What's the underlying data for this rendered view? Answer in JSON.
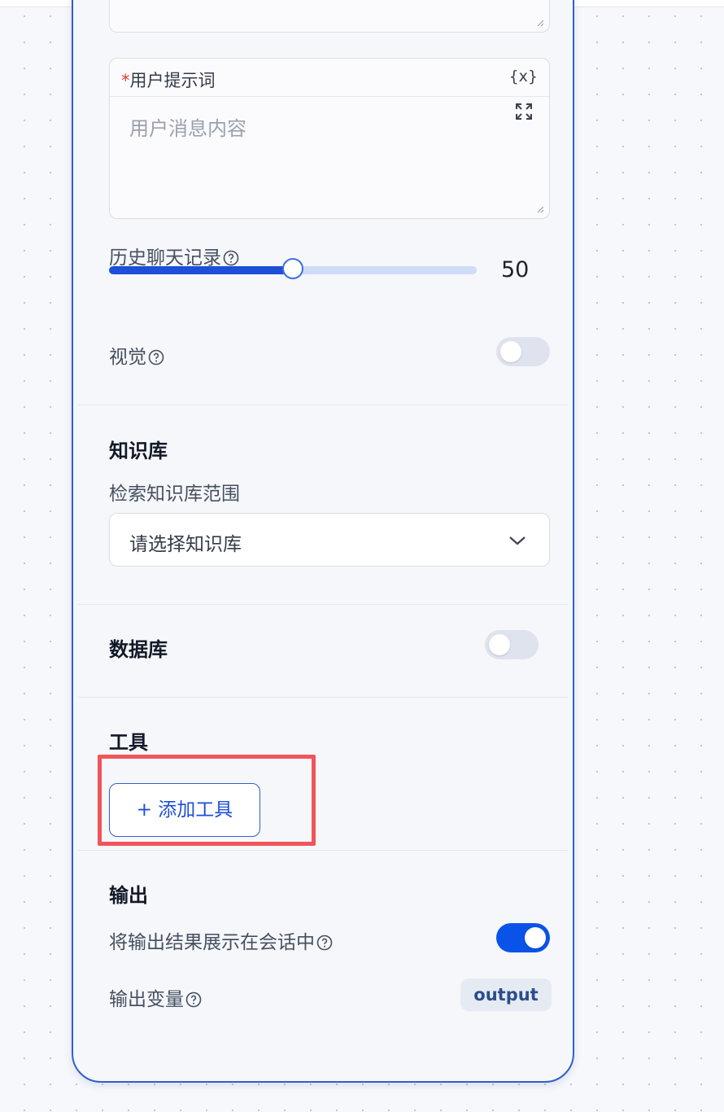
{
  "user_prompt": {
    "required_mark": "*",
    "label": "用户提示词",
    "var_icon_text": "{x}",
    "placeholder": "用户消息内容"
  },
  "history": {
    "label": "历史聊天记录",
    "value_text": "50",
    "fill_fraction": 0.5
  },
  "vision": {
    "label": "视觉",
    "enabled": false
  },
  "knowledge": {
    "title": "知识库",
    "scope_label": "检索知识库范围",
    "select_placeholder": "请选择知识库"
  },
  "database": {
    "title": "数据库",
    "enabled": false
  },
  "tools": {
    "title": "工具",
    "add_button": "+ 添加工具"
  },
  "output": {
    "title": "输出",
    "show_in_chat_label": "将输出结果展示在会话中",
    "show_in_chat_enabled": true,
    "variable_label": "输出变量",
    "variable_name": "output"
  },
  "colors": {
    "accent": "#0a53e8",
    "highlight": "#f0555a",
    "required": "#e23d3d"
  }
}
